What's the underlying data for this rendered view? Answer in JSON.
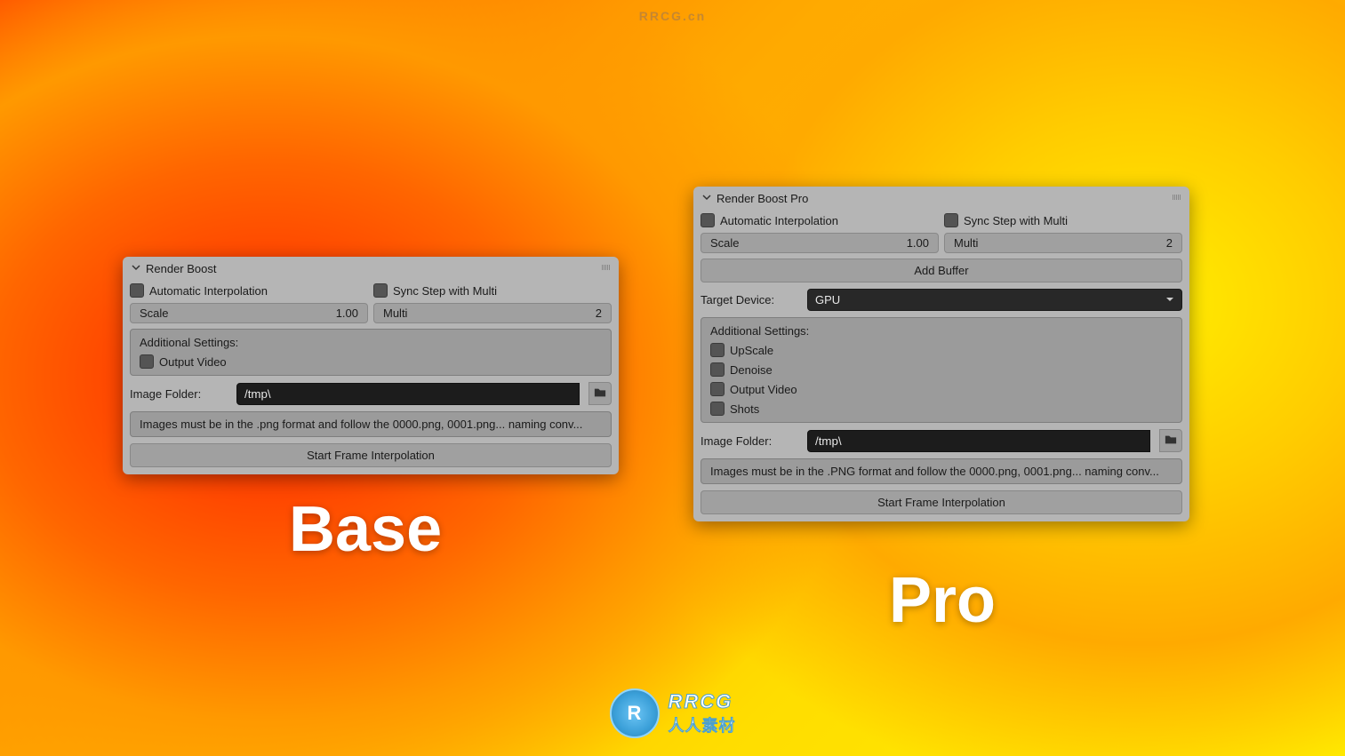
{
  "watermark_top": "RRCG.cn",
  "base": {
    "title": "Render Boost",
    "auto_interp": "Automatic Interpolation",
    "sync_step": "Sync Step with Multi",
    "scale_label": "Scale",
    "scale_value": "1.00",
    "multi_label": "Multi",
    "multi_value": "2",
    "additional_settings": "Additional Settings:",
    "output_video": "Output Video",
    "image_folder_label": "Image Folder:",
    "image_folder_value": "/tmp\\",
    "info_text": "Images must be in the .png format and follow the 0000.png, 0001.png... naming conv...",
    "start_button": "Start Frame Interpolation",
    "big_label": "Base"
  },
  "pro": {
    "title": "Render Boost Pro",
    "auto_interp": "Automatic Interpolation",
    "sync_step": "Sync Step with Multi",
    "scale_label": "Scale",
    "scale_value": "1.00",
    "multi_label": "Multi",
    "multi_value": "2",
    "add_buffer": "Add Buffer",
    "target_device_label": "Target Device:",
    "target_device_value": "GPU",
    "additional_settings": "Additional Settings:",
    "upscale": "UpScale",
    "denoise": "Denoise",
    "output_video": "Output Video",
    "shots": "Shots",
    "image_folder_label": "Image Folder:",
    "image_folder_value": "/tmp\\",
    "info_text": "Images must be in the .PNG format and follow the 0000.png, 0001.png... naming conv...",
    "start_button": "Start Frame Interpolation",
    "big_label": "Pro"
  },
  "logo": {
    "text1": "RRCG",
    "text2": "人人素材"
  }
}
